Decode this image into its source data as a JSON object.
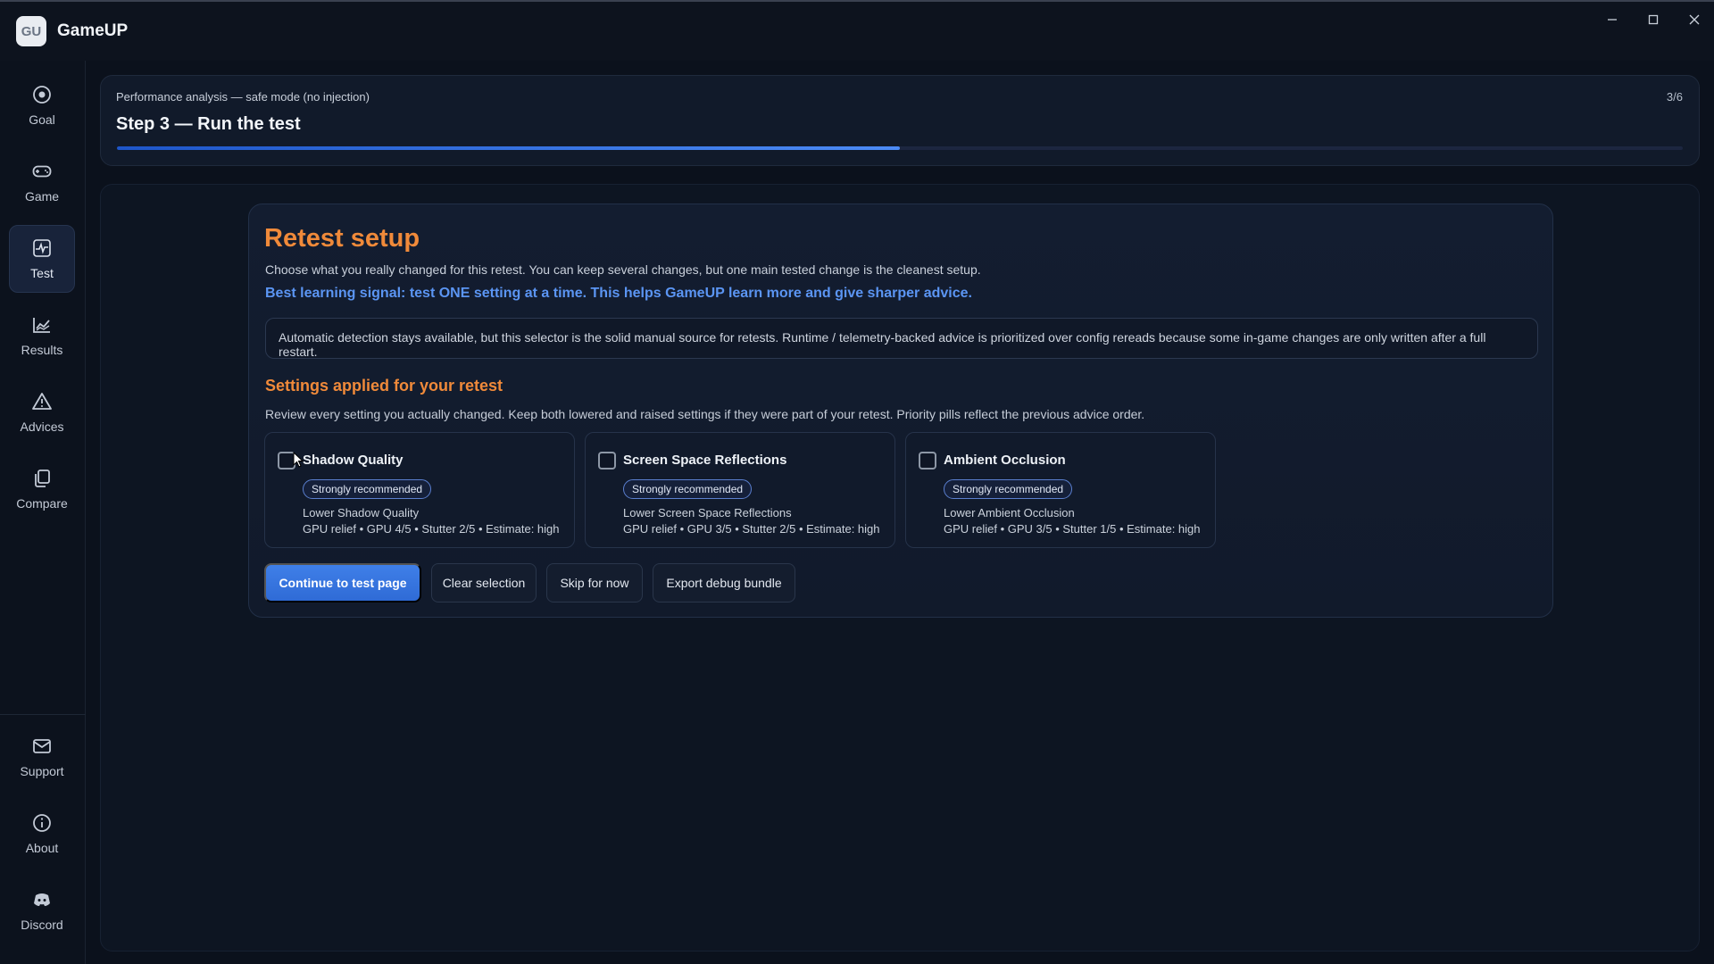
{
  "app": {
    "logo": "GU",
    "title": "GameUP"
  },
  "window_controls": [
    "minimize-icon",
    "maximize-icon",
    "close-icon"
  ],
  "sidebar": {
    "items": [
      {
        "label": "Goal",
        "icon": "target-icon"
      },
      {
        "label": "Game",
        "icon": "gamepad-icon"
      },
      {
        "label": "Test",
        "icon": "pulse-icon",
        "active": true
      },
      {
        "label": "Results",
        "icon": "chart-icon"
      },
      {
        "label": "Advices",
        "icon": "warning-icon"
      },
      {
        "label": "Compare",
        "icon": "copy-icon"
      }
    ],
    "bottom_items": [
      {
        "label": "Support",
        "icon": "mail-icon"
      },
      {
        "label": "About",
        "icon": "info-icon"
      },
      {
        "label": "Discord",
        "icon": "discord-icon"
      }
    ]
  },
  "step": {
    "subtitle": "Performance analysis — safe mode (no injection)",
    "title": "Step 3 — Run the test",
    "count": "3/6",
    "progress": 0.5
  },
  "retest": {
    "title": "Retest setup",
    "description": "Choose what you really changed for this retest. You can keep several changes, but one main tested change is the cleanest setup.",
    "highlight": "Best learning signal: test ONE setting at a time. This helps GameUP learn more and give sharper advice.",
    "info": "Automatic detection stays available, but this selector is the solid manual source for retests. Runtime / telemetry-backed advice is prioritized over config rereads because some in-game changes are only written after a full restart.",
    "section_title": "Settings applied for your retest",
    "section_desc": "Review every setting you actually changed. Keep both lowered and raised settings if they were part of your retest. Priority pills reflect the previous advice order.",
    "settings": [
      {
        "name": "Shadow Quality",
        "pill": "Strongly recommended",
        "line1": "Lower Shadow Quality",
        "line2": "GPU relief • GPU 4/5 • Stutter 2/5 • Estimate: high",
        "checked": false
      },
      {
        "name": "Screen Space Reflections",
        "pill": "Strongly recommended",
        "line1": "Lower Screen Space Reflections",
        "line2": "GPU relief • GPU 3/5 • Stutter 2/5 • Estimate: high",
        "checked": false
      },
      {
        "name": "Ambient Occlusion",
        "pill": "Strongly recommended",
        "line1": "Lower Ambient Occlusion",
        "line2": "GPU relief • GPU 3/5 • Stutter 1/5 • Estimate: high",
        "checked": false
      }
    ],
    "buttons": {
      "continue": "Continue to test page",
      "clear": "Clear selection",
      "skip": "Skip for now",
      "export": "Export debug bundle"
    }
  },
  "colors": {
    "accent_orange": "#f08a3a",
    "accent_blue": "#5b95f3",
    "primary_button": "#3577e0"
  }
}
